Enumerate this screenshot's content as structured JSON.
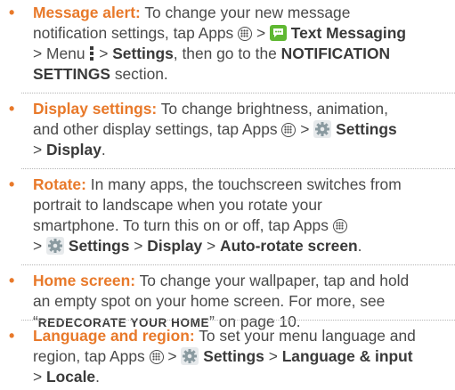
{
  "bullets": [
    {
      "title": "Message alert:",
      "lines": [
        "To change your new message",
        "notification settings, tap Apps",
        "Text Messaging",
        "> Menu",
        "Settings",
        ", then go to the",
        "NOTIFICATION",
        "SETTINGS",
        "section."
      ]
    },
    {
      "title": "Display settings:",
      "lines": [
        "To change brightness, animation,",
        "and other display settings, tap Apps",
        "Settings",
        "Display"
      ]
    },
    {
      "title": "Rotate:",
      "lines": [
        "In many apps, the touchscreen switches from",
        "portrait to landscape when you rotate your",
        "smartphone. To turn this on or off, tap Apps",
        "Settings",
        "Display",
        "Auto-rotate screen"
      ]
    },
    {
      "title": "Home screen:",
      "lines": [
        "To change your wallpaper, tap and hold",
        "an empty spot on your home screen. For more, see",
        "REDECORATE YOUR HOME",
        "on page 10."
      ]
    },
    {
      "title": "Language and region:",
      "lines": [
        "To set your menu language and",
        "region, tap Apps",
        "Settings",
        "Language & input",
        "Locale"
      ]
    }
  ],
  "glyphs": {
    "bullet": "•",
    "arrow": ">",
    "quote_open": "“",
    "quote_close": "”"
  },
  "icons": {
    "apps": "apps-grid-icon",
    "messaging": "text-messaging-icon",
    "menu": "menu-dots-icon",
    "settings": "settings-gear-icon"
  },
  "colors": {
    "accent": "#e8792a",
    "text": "#4a4a4a",
    "messaging_green": "#5fb832",
    "gear_gray": "#8a9aa0"
  }
}
